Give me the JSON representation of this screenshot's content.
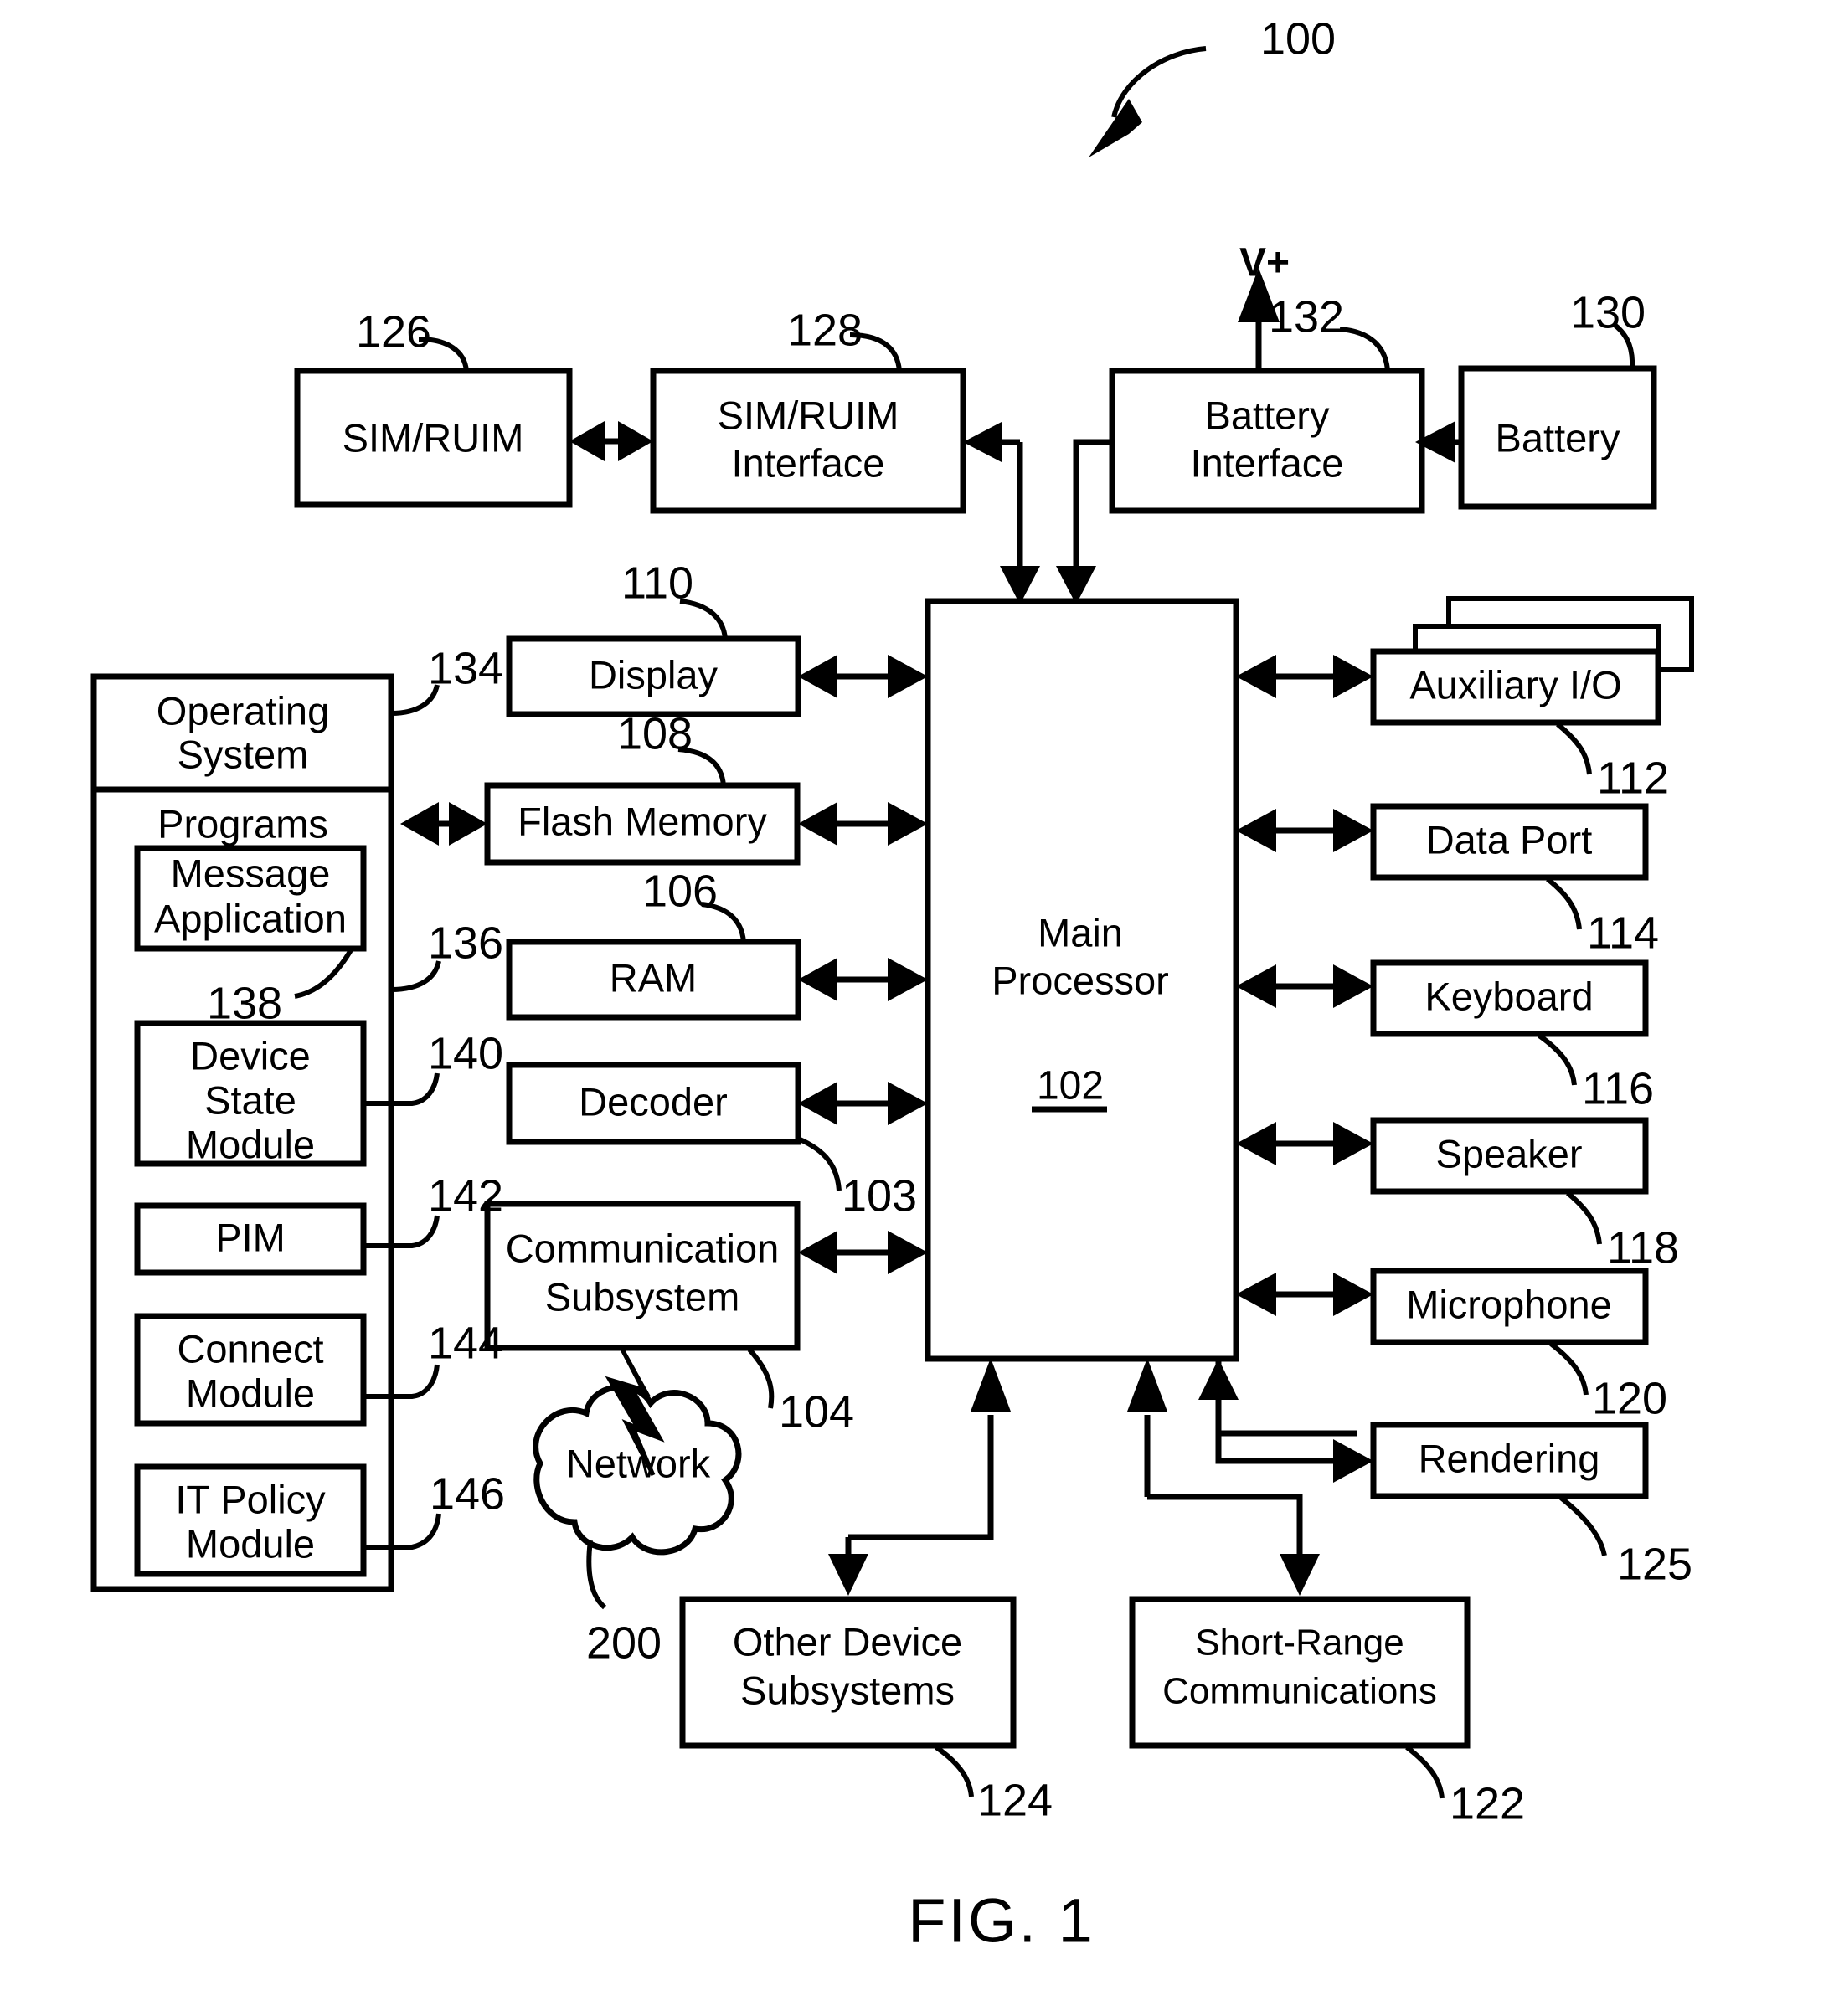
{
  "figure": {
    "caption": "FIG. 1",
    "system_ref": "100"
  },
  "blocks": {
    "sim_ruim": {
      "label": "SIM/RUIM",
      "ref": "126"
    },
    "sim_ruim_interface": {
      "line1": "SIM/RUIM",
      "line2": "Interface",
      "ref": "128"
    },
    "battery_interface": {
      "line1": "Battery",
      "line2": "Interface",
      "ref": "132"
    },
    "battery": {
      "label": "Battery",
      "ref": "130"
    },
    "v_plus": {
      "label": "V+"
    },
    "display": {
      "label": "Display",
      "ref": "110"
    },
    "flash_memory": {
      "label": "Flash Memory",
      "ref": "108"
    },
    "ram": {
      "label": "RAM",
      "ref": "106"
    },
    "decoder": {
      "label": "Decoder",
      "ref": "103"
    },
    "communication_subsystem": {
      "line1": "Communication",
      "line2": "Subsystem",
      "ref": "104"
    },
    "network": {
      "label": "Network",
      "ref": "200"
    },
    "main_processor": {
      "line1": "Main",
      "line2": "Processor",
      "ref": "102"
    },
    "auxiliary_io": {
      "label": "Auxiliary I/O",
      "ref": "112"
    },
    "data_port": {
      "label": "Data Port",
      "ref": "114"
    },
    "keyboard": {
      "label": "Keyboard",
      "ref": "116"
    },
    "speaker": {
      "label": "Speaker",
      "ref": "118"
    },
    "microphone": {
      "label": "Microphone",
      "ref": "120"
    },
    "rendering": {
      "label": "Rendering",
      "ref": "125"
    },
    "other_device_subsystems": {
      "line1": "Other Device",
      "line2": "Subsystems",
      "ref": "124"
    },
    "short_range_communications": {
      "line1": "Short-Range",
      "line2": "Communications",
      "ref": "122"
    }
  },
  "software_panel": {
    "operating_system": {
      "line1": "Operating",
      "line2": "System",
      "ref": "134"
    },
    "programs": {
      "label": "Programs",
      "ref": "136"
    },
    "message_application": {
      "line1": "Message",
      "line2": "Application",
      "ref": "138"
    },
    "device_state_module": {
      "line1": "Device",
      "line2": "State",
      "line3": "Module",
      "ref": "140"
    },
    "pim": {
      "label": "PIM",
      "ref": "142"
    },
    "connect_module": {
      "line1": "Connect",
      "line2": "Module",
      "ref": "144"
    },
    "it_policy_module": {
      "line1": "IT Policy",
      "line2": "Module",
      "ref": "146"
    }
  }
}
